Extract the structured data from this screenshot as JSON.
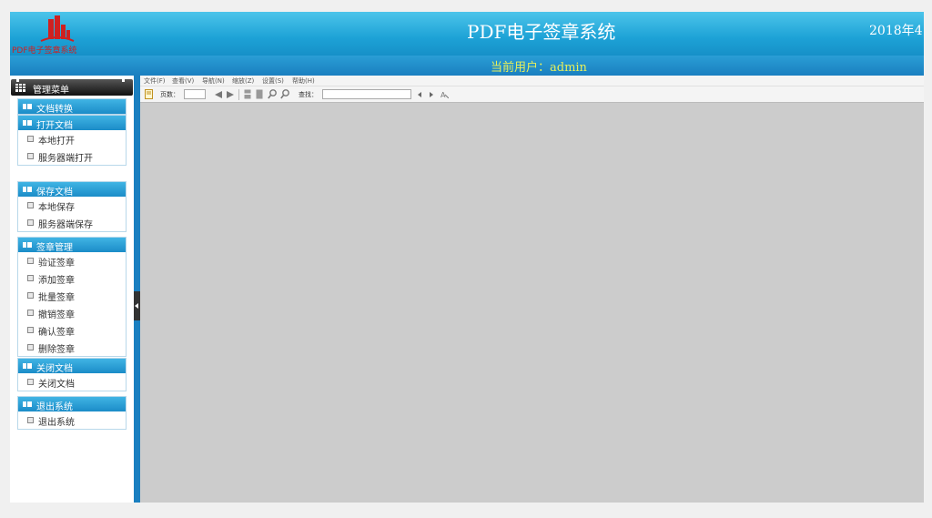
{
  "header": {
    "logo_text": "PDF电子签章系统",
    "title": "PDF电子签章系统",
    "date": "2018年4"
  },
  "userbar": {
    "text": "当前用户：admin"
  },
  "sidebar": {
    "title": "管理菜单",
    "groups": [
      {
        "label": "文档转换",
        "items": []
      },
      {
        "label": "打开文档",
        "items": [
          "本地打开",
          "服务器端打开"
        ]
      },
      {
        "label": "保存文档",
        "items": [
          "本地保存",
          "服务器端保存"
        ]
      },
      {
        "label": "签章管理",
        "items": [
          "验证签章",
          "添加签章",
          "批量签章",
          "撤销签章",
          "确认签章",
          "删除签章"
        ]
      },
      {
        "label": "关闭文档",
        "items": [
          "关闭文档"
        ]
      },
      {
        "label": "退出系统",
        "items": [
          "退出系统"
        ]
      }
    ]
  },
  "viewer": {
    "menu": [
      "文件(F)",
      "查看(V)",
      "导航(N)",
      "缩放(Z)",
      "设置(S)",
      "帮助(H)"
    ],
    "toolbar": {
      "page_label": "页数：",
      "page_value": "",
      "find_label": "查找：",
      "find_value": ""
    }
  },
  "colors": {
    "header_blue": "#1da2d6",
    "user_text": "#e8f05a",
    "viewer_bg": "#cccccc",
    "logo_red": "#d02020"
  },
  "icons": {
    "group": "book-icon",
    "item": "page-icon",
    "menu": "grid-icon"
  }
}
